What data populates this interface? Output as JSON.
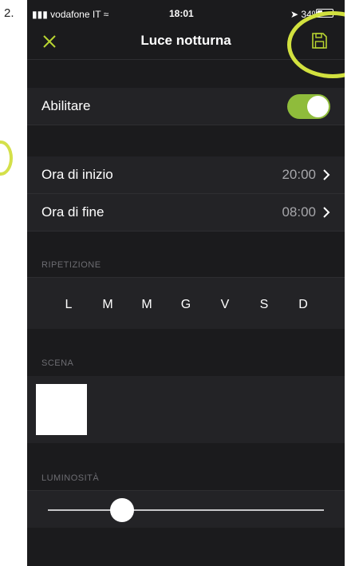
{
  "annotation": {
    "step_label": "2."
  },
  "status_bar": {
    "carrier": "vodafone IT",
    "time": "18:01",
    "battery_pct": "34%",
    "battery_level": 0.34
  },
  "navbar": {
    "title": "Luce notturna",
    "close_icon": "close-icon",
    "save_icon": "floppy-disk-icon",
    "accent_color": "#b9d531"
  },
  "enable": {
    "label": "Abilitare",
    "on": true,
    "toggle_color": "#8fbc3b"
  },
  "schedule": {
    "start_label": "Ora di inizio",
    "start_value": "20:00",
    "end_label": "Ora di fine",
    "end_value": "08:00"
  },
  "repetition": {
    "header": "RIPETIZIONE",
    "days": [
      "L",
      "M",
      "M",
      "G",
      "V",
      "S",
      "D"
    ]
  },
  "scene": {
    "header": "SCENA",
    "swatch_color": "#ffffff"
  },
  "brightness": {
    "header": "LUMINOSITÀ",
    "level": 0.27
  }
}
